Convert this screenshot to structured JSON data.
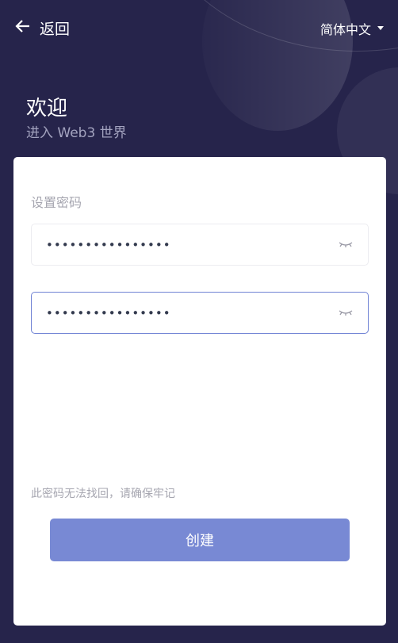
{
  "header": {
    "back_label": "返回",
    "language": "简体中文"
  },
  "welcome": {
    "title": "欢迎",
    "subtitle": "进入 Web3 世界"
  },
  "form": {
    "label": "设置密码",
    "password": "••••••••••••••••",
    "confirm_password": "••••••••••••••••",
    "hint": "此密码无法找回，请确保牢记",
    "create_label": "创建"
  },
  "colors": {
    "background": "#26244b",
    "accent": "#7889d4",
    "focus_border": "#6f82d4"
  }
}
